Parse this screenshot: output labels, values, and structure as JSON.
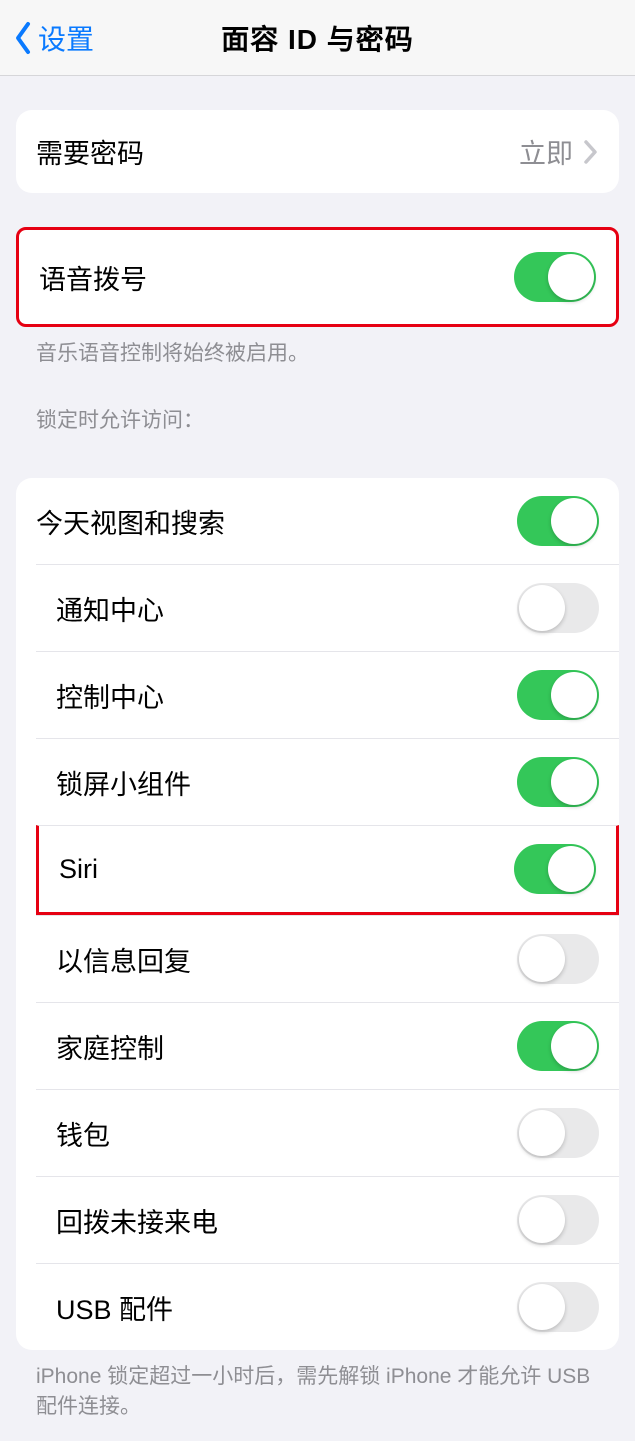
{
  "nav": {
    "back_label": "设置",
    "title": "面容 ID 与密码"
  },
  "passcode": {
    "label": "需要密码",
    "value": "立即"
  },
  "voice_dial": {
    "label": "语音拨号",
    "on": true,
    "note": "音乐语音控制将始终被启用。"
  },
  "allow_header": "锁定时允许访问：",
  "items": [
    {
      "label": "今天视图和搜索",
      "on": true
    },
    {
      "label": "通知中心",
      "on": false
    },
    {
      "label": "控制中心",
      "on": true
    },
    {
      "label": "锁屏小组件",
      "on": true
    },
    {
      "label": "Siri",
      "on": true
    },
    {
      "label": "以信息回复",
      "on": false
    },
    {
      "label": "家庭控制",
      "on": true
    },
    {
      "label": "钱包",
      "on": false
    },
    {
      "label": "回拨未接来电",
      "on": false
    },
    {
      "label": "USB 配件",
      "on": false
    }
  ],
  "usb_note": "iPhone 锁定超过一小时后，需先解锁 iPhone 才能允许 USB 配件连接。"
}
